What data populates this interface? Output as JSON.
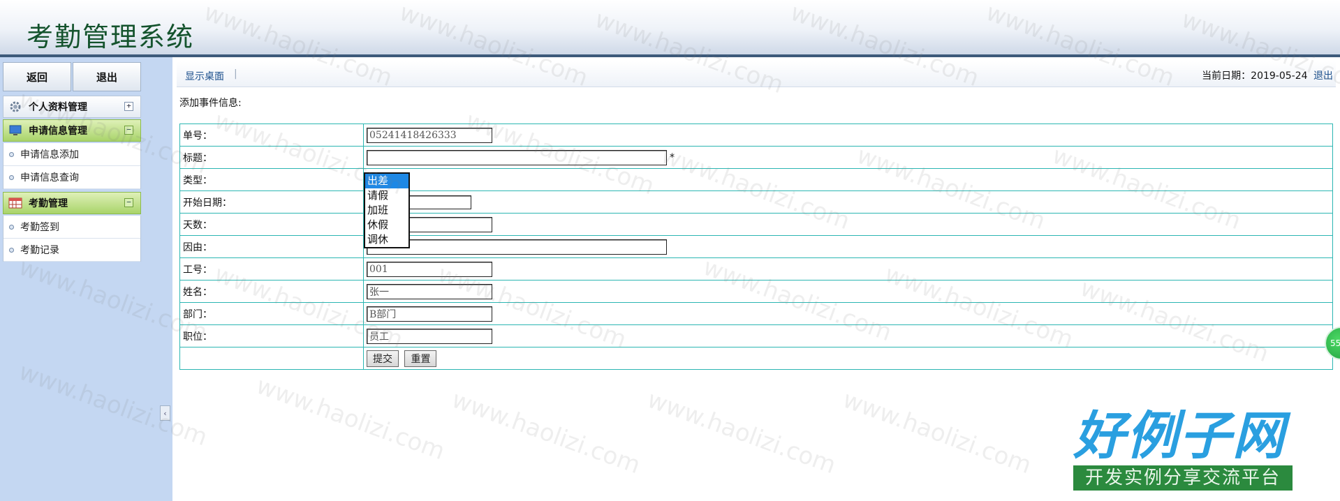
{
  "app": {
    "title": "考勤管理系统"
  },
  "sidebar": {
    "back_label": "返回",
    "logout_label": "退出",
    "groups": [
      {
        "label": "个人资料管理",
        "toggle": "+",
        "icon": "gear-icon"
      },
      {
        "label": "申请信息管理",
        "toggle": "−",
        "icon": "monitor-icon",
        "items": [
          "申请信息添加",
          "申请信息查询"
        ]
      },
      {
        "label": "考勤管理",
        "toggle": "−",
        "icon": "calendar-icon",
        "items": [
          "考勤签到",
          "考勤记录"
        ]
      }
    ],
    "collapse_glyph": "‹"
  },
  "topbar": {
    "desktop_link": "显示桌面",
    "separator": "|",
    "date_label": "当前日期：2019-05-24",
    "logout_link": "退出"
  },
  "form": {
    "caption": "添加事件信息:",
    "fields": {
      "order_no": {
        "label": "单号：",
        "value": "05241418426333"
      },
      "title": {
        "label": "标题：",
        "value": "",
        "required_mark": "*"
      },
      "type": {
        "label": "类型：",
        "options": [
          "出差",
          "请假",
          "加班",
          "休假",
          "调休"
        ],
        "selected": "出差"
      },
      "start_date": {
        "label": "开始日期：",
        "value": ""
      },
      "days": {
        "label": "天数：",
        "value": ""
      },
      "reason": {
        "label": "因由：",
        "value": ""
      },
      "emp_no": {
        "label": "工号：",
        "value": "001"
      },
      "name": {
        "label": "姓名：",
        "value": "张一"
      },
      "department": {
        "label": "部门：",
        "value": "B部门"
      },
      "position": {
        "label": "职位：",
        "value": "员工"
      }
    },
    "submit_label": "提交",
    "reset_label": "重置"
  },
  "watermark": {
    "text": "www.haolizi.com"
  },
  "logo": {
    "title": "好例子网",
    "subtitle": "开发实例分享交流平台"
  },
  "badge": {
    "text": "55"
  },
  "colors": {
    "header_border": "#3d5a7a",
    "table_border": "#2bb6b2",
    "active_menu": "#a9d46a",
    "link": "#1b4f8c",
    "option_selected": "#1e88e5"
  }
}
